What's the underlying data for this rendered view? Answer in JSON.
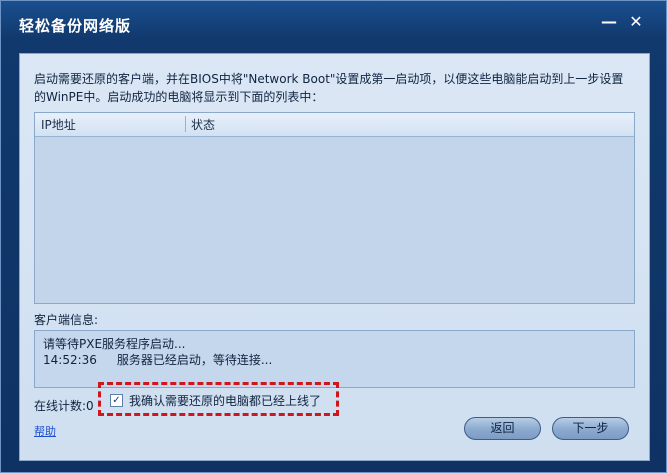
{
  "window": {
    "title": "轻松备份网络版",
    "minimize_symbol": "—",
    "close_symbol": "✕"
  },
  "instruction": "启动需要还原的客户端，并在BIOS中将\"Network Boot\"设置成第一启动项，以便这些电脑能启动到上一步设置的WinPE中。启动成功的电脑将显示到下面的列表中：",
  "table": {
    "columns": [
      "IP地址",
      "状态"
    ]
  },
  "client_info": {
    "label": "客户端信息:",
    "log_line1": "请等待PXE服务程序启动...",
    "log_time": "14:52:36",
    "log_msg": "服务器已经启动，等待连接..."
  },
  "online_count": "在线计数:0",
  "confirm": {
    "checked": true,
    "check_mark": "✓",
    "label": "我确认需要还原的电脑都已经上线了"
  },
  "help_link": "帮助",
  "buttons": {
    "back": "返回",
    "next": "下一步"
  }
}
